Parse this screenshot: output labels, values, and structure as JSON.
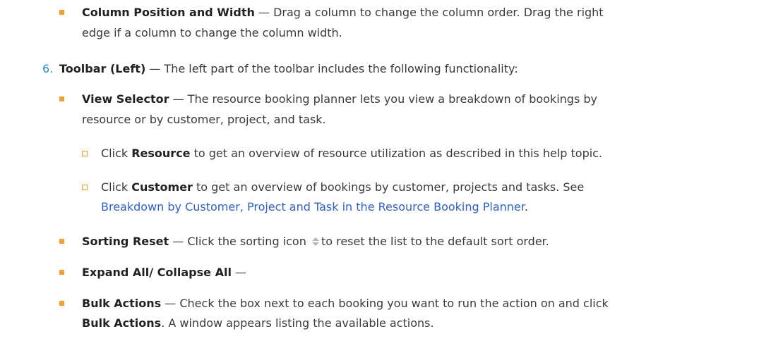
{
  "items": {
    "column_position": {
      "title": "Column Position and Width",
      "desc_line1": " — Drag a column to change the column order. Drag the right",
      "desc_line2": "edge if a column to change the column width."
    },
    "toolbar_left": {
      "number": "6.",
      "title": "Toolbar (Left)",
      "desc": " — The left part of the toolbar includes the following functionality:"
    },
    "view_selector": {
      "title": "View Selector",
      "desc_line1": " — The resource booking planner lets you view a breakdown of bookings by",
      "desc_line2": "resource or by customer, project, and task."
    },
    "sub_resource": {
      "pre": "Click ",
      "bold": "Resource",
      "post": " to get an overview of resource utilization as described in this help topic."
    },
    "sub_customer": {
      "pre": "Click ",
      "bold": "Customer",
      "post": " to get an overview of bookings by customer, projects and tasks. See",
      "link": "Breakdown by Customer, Project and Task in the Resource Booking Planner",
      "link_end": "."
    },
    "sorting_reset": {
      "title": "Sorting Reset",
      "pre": " — Click the sorting icon",
      "icon": "sort-icon",
      "post": "to reset the list to the default sort order."
    },
    "expand_all": {
      "title": "Expand All/ Collapse All",
      "desc": " —"
    },
    "bulk_actions": {
      "title": "Bulk Actions",
      "desc_line1": " — Check the box next to each booking you want to run the action on and click",
      "bold_line2": "Bulk Actions",
      "desc_line2": ". A window appears listing the available actions."
    }
  },
  "colors": {
    "bullet": "#f0a037",
    "number": "#2a8ad4",
    "link": "#2f62c9",
    "text": "#3a3a3a"
  }
}
